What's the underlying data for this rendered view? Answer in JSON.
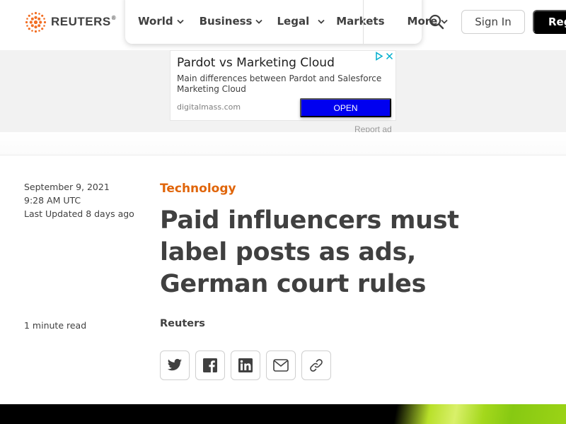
{
  "header": {
    "logo_text": "REUTERS",
    "logo_reg": "®",
    "nav": [
      {
        "label": "World",
        "has_dropdown": true
      },
      {
        "label": "Business",
        "has_dropdown": true
      },
      {
        "label": "Legal",
        "has_dropdown": true
      },
      {
        "label": "Markets",
        "has_dropdown": false
      },
      {
        "label": "More",
        "has_dropdown": true
      }
    ],
    "search_icon": "search-icon",
    "sign_in_label": "Sign In",
    "register_label": "Reg"
  },
  "ad": {
    "title": "Pardot vs Marketing Cloud",
    "description": "Main differences between Pardot and Salesforce Marketing Cloud",
    "domain": "digitalmass.com",
    "cta_label": "OPEN",
    "report_label": "Report ad",
    "cta_color": "#0000f0"
  },
  "article": {
    "date": "September 9, 2021",
    "time": "9:28 AM UTC",
    "updated": "Last Updated 8 days ago",
    "category": "Technology",
    "category_color": "#e0650a",
    "headline": "Paid influencers must label posts as ads, German court rules",
    "read_time": "1 minute read",
    "author": "Reuters",
    "share_icons": [
      "twitter-icon",
      "facebook-icon",
      "linkedin-icon",
      "email-icon",
      "link-icon"
    ]
  },
  "colors": {
    "text": "#404040",
    "accent_orange": "#e0650a",
    "ad_band": "#f2f2f2"
  }
}
